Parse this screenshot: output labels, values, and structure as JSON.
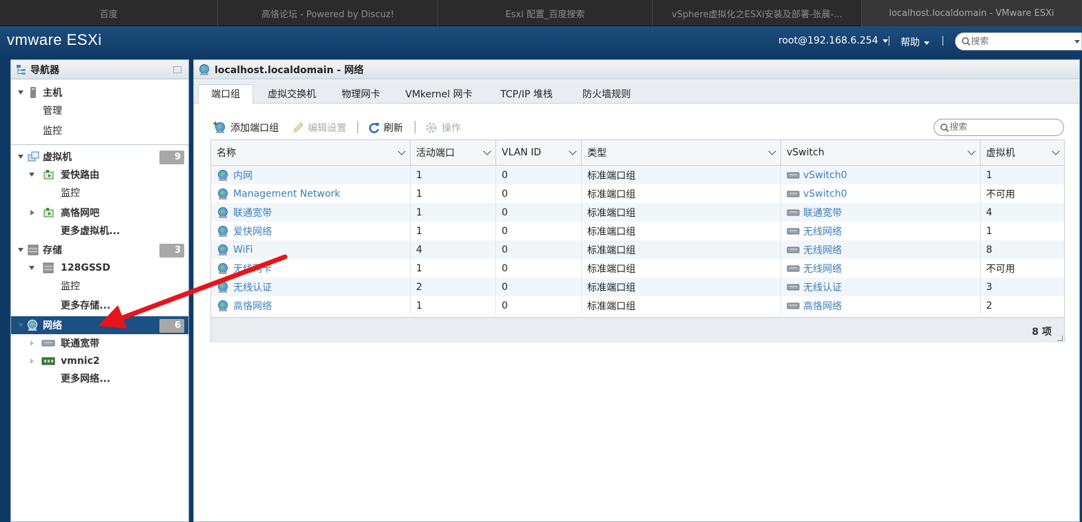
{
  "browser_tabs": [
    "百度",
    "高恪论坛 - Powered by Discuz!",
    "Esxi 配置_百度搜索",
    "vSphere虚拟化之ESXi安装及部署-张晨-...",
    "localhost.localdomain - VMware ESXi"
  ],
  "header": {
    "brand": "vmware ESXi",
    "user": "root@192.168.6.254",
    "separator": "|",
    "help": "帮助",
    "search_placeholder": "搜索"
  },
  "navigator": {
    "title": "导航器",
    "host": "主机",
    "host_manage": "管理",
    "host_monitor": "监控",
    "vms": "虚拟机",
    "vms_count": "9",
    "vm1": "爱快路由",
    "vm1_monitor": "监控",
    "vm2": "高恪网吧",
    "more_vms": "更多虚拟机...",
    "storage": "存储",
    "storage_count": "3",
    "datastore": "128GSSD",
    "datastore_monitor": "监控",
    "more_storage": "更多存储...",
    "network": "网络",
    "network_count": "6",
    "net1": "联通宽带",
    "net2": "vmnic2",
    "more_network": "更多网络..."
  },
  "main": {
    "title": "localhost.localdomain - 网络",
    "tabs": [
      "端口组",
      "虚拟交换机",
      "物理网卡",
      "VMkernel 网卡",
      "TCP/IP 堆栈",
      "防火墙规则"
    ],
    "toolbar": {
      "add": "添加端口组",
      "edit": "编辑设置",
      "refresh": "刷新",
      "actions": "操作",
      "search_placeholder": "搜索"
    },
    "columns": [
      "名称",
      "活动端口",
      "VLAN ID",
      "类型",
      "vSwitch",
      "虚拟机"
    ],
    "rows": [
      {
        "name": "内网",
        "ports": "1",
        "vlan": "0",
        "type": "标准端口组",
        "vswitch": "vSwitch0",
        "vms": "1"
      },
      {
        "name": "Management Network",
        "ports": "1",
        "vlan": "0",
        "type": "标准端口组",
        "vswitch": "vSwitch0",
        "vms": "不可用"
      },
      {
        "name": "联通宽带",
        "ports": "1",
        "vlan": "0",
        "type": "标准端口组",
        "vswitch": "联通宽带",
        "vms": "4"
      },
      {
        "name": "爱快网络",
        "ports": "1",
        "vlan": "0",
        "type": "标准端口组",
        "vswitch": "无线网络",
        "vms": "1"
      },
      {
        "name": "WiFi",
        "ports": "4",
        "vlan": "0",
        "type": "标准端口组",
        "vswitch": "无线网络",
        "vms": "8"
      },
      {
        "name": "无线网卡",
        "ports": "1",
        "vlan": "0",
        "type": "标准端口组",
        "vswitch": "无线网络",
        "vms": "不可用"
      },
      {
        "name": "无线认证",
        "ports": "2",
        "vlan": "0",
        "type": "标准端口组",
        "vswitch": "无线认证",
        "vms": "3"
      },
      {
        "name": "高恪网络",
        "ports": "1",
        "vlan": "0",
        "type": "标准端口组",
        "vswitch": "高恪网络",
        "vms": "2"
      }
    ],
    "item_count": "8 项"
  },
  "colors": {
    "header": "#1d4d7e",
    "selected": "#1c4f82",
    "link": "#3b7dbb",
    "annotation_arrow": "#e8141b"
  }
}
